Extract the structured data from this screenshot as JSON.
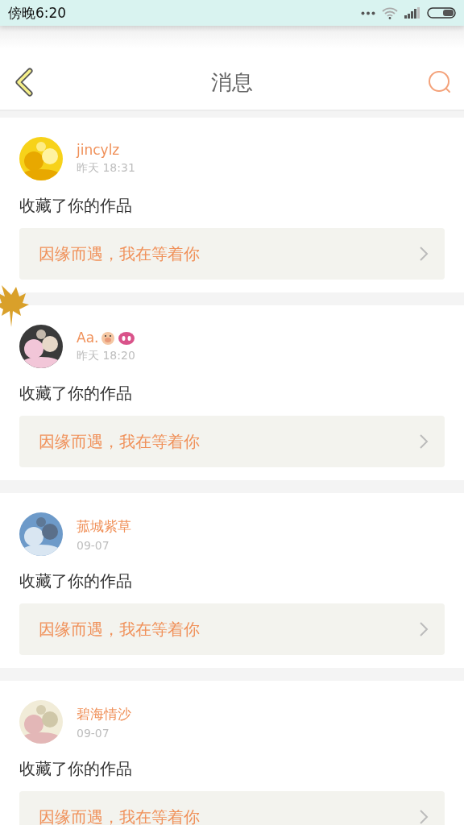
{
  "status_bar": {
    "time": "傍晚6:20"
  },
  "header": {
    "title": "消息"
  },
  "messages": [
    {
      "name": "jincylz",
      "time": "昨天 18:31",
      "action": "收藏了你的作品",
      "link": "因缘而遇，我在等着你"
    },
    {
      "name": "Aa.",
      "name_icons": [
        {
          "kind": "pig-face"
        },
        {
          "kind": "pig-nose"
        }
      ],
      "time": "昨天 18:20",
      "action": "收藏了你的作品",
      "link": "因缘而遇，我在等着你"
    },
    {
      "name": "菰城紫草",
      "time": "09-07",
      "action": "收藏了你的作品",
      "link": "因缘而遇，我在等着你"
    },
    {
      "name": "碧海情沙",
      "time": "09-07",
      "action": "收藏了你的作品",
      "link": "因缘而遇，我在等着你"
    }
  ]
}
